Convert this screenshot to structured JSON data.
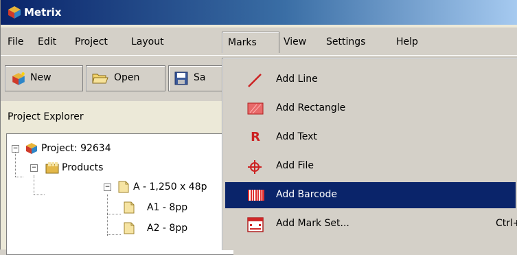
{
  "window": {
    "title": "Metrix"
  },
  "menubar": {
    "items": [
      "File",
      "Edit",
      "Project",
      "Layout",
      "Marks",
      "View",
      "Settings",
      "Help"
    ],
    "open_menu": "Marks"
  },
  "toolbar": {
    "new_label": "New",
    "open_label": "Open",
    "save_label": "Sa"
  },
  "explorer": {
    "header": "Project Explorer",
    "tree": {
      "project": "Project: 92634",
      "products": "Products",
      "product_a": "A - 1,250 x 48p",
      "a1": "A1 - 8pp",
      "a2": "A2 - 8pp"
    }
  },
  "marks_menu": {
    "items": [
      {
        "label": "Add Line",
        "icon": "line-icon",
        "shortcut": ""
      },
      {
        "label": "Add Rectangle",
        "icon": "rectangle-icon",
        "shortcut": ""
      },
      {
        "label": "Add Text",
        "icon": "text-icon",
        "shortcut": ""
      },
      {
        "label": "Add File",
        "icon": "crosshair-icon",
        "shortcut": ""
      },
      {
        "label": "Add Barcode",
        "icon": "barcode-icon",
        "shortcut": "",
        "highlighted": true
      },
      {
        "label": "Add Mark Set...",
        "icon": "mark-set-icon",
        "shortcut": "Ctrl+M"
      }
    ],
    "text_glyph": "R"
  },
  "colors": {
    "title_start": "#0a246a",
    "title_end": "#a6caf0",
    "highlight": "#0a246a",
    "face": "#d4d0c8",
    "icon_red": "#cc2222"
  }
}
